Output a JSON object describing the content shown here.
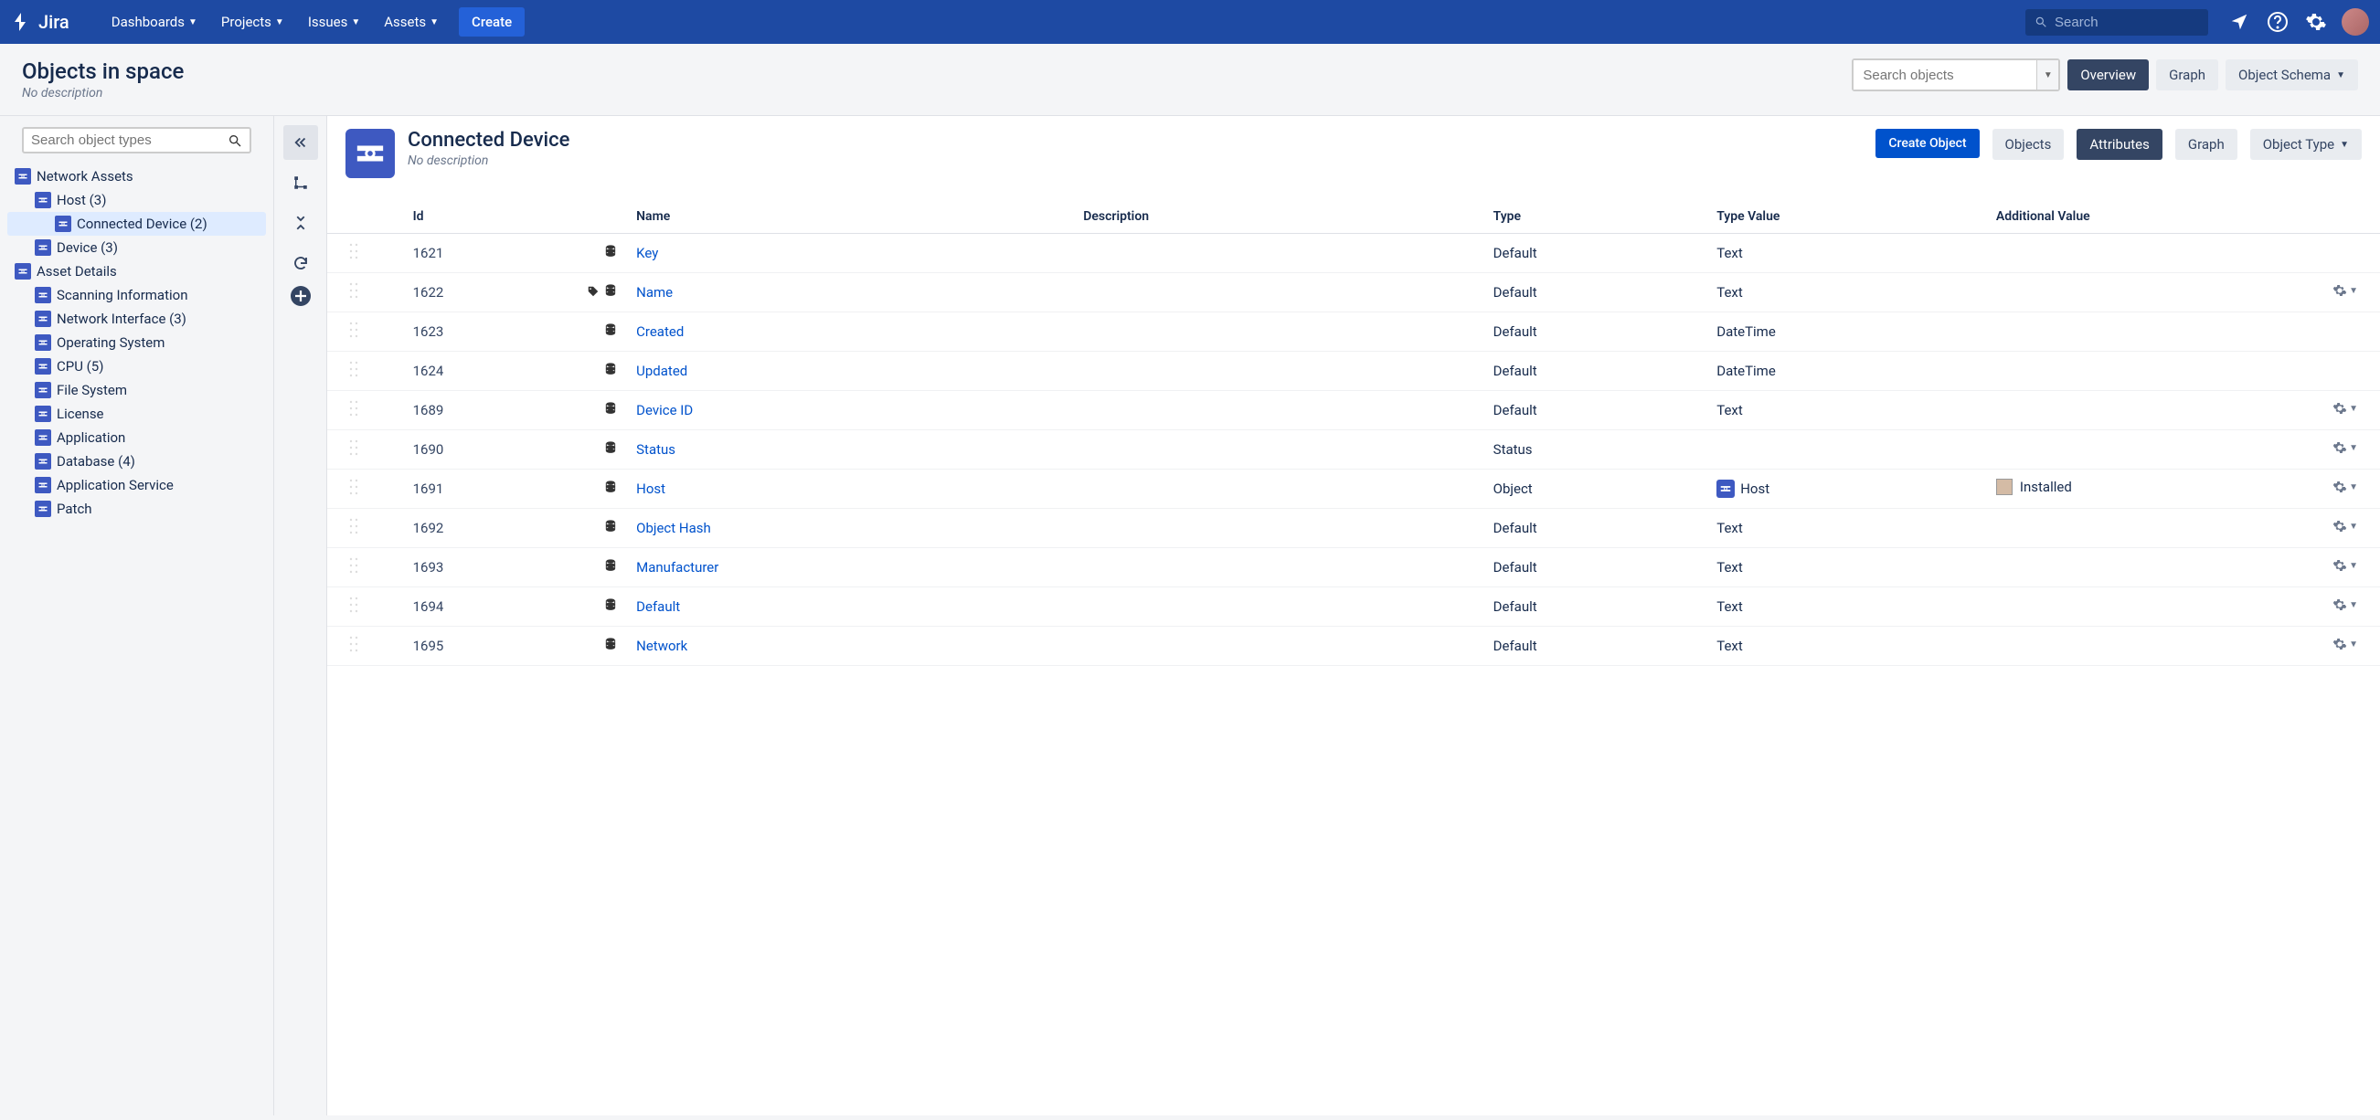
{
  "topnav": {
    "logo": "Jira",
    "items": [
      "Dashboards",
      "Projects",
      "Issues",
      "Assets"
    ],
    "create": "Create",
    "search_placeholder": "Search"
  },
  "pagehead": {
    "title": "Objects in space",
    "desc": "No description",
    "search_placeholder": "Search objects",
    "overview": "Overview",
    "graph": "Graph",
    "schema": "Object Schema"
  },
  "sidebar": {
    "search_placeholder": "Search object types",
    "tree": [
      {
        "label": "Network Assets",
        "indent": 0
      },
      {
        "label": "Host (3)",
        "indent": 1
      },
      {
        "label": "Connected Device (2)",
        "indent": 2,
        "selected": true
      },
      {
        "label": "Device (3)",
        "indent": 1
      },
      {
        "label": "Asset Details",
        "indent": 0
      },
      {
        "label": "Scanning Information",
        "indent": 1
      },
      {
        "label": "Network Interface (3)",
        "indent": 1
      },
      {
        "label": "Operating System",
        "indent": 1
      },
      {
        "label": "CPU (5)",
        "indent": 1
      },
      {
        "label": "File System",
        "indent": 1
      },
      {
        "label": "License",
        "indent": 1
      },
      {
        "label": "Application",
        "indent": 1
      },
      {
        "label": "Database (4)",
        "indent": 1
      },
      {
        "label": "Application Service",
        "indent": 1
      },
      {
        "label": "Patch",
        "indent": 1
      }
    ]
  },
  "content": {
    "title": "Connected Device",
    "desc": "No description",
    "create": "Create Object",
    "tabs": {
      "objects": "Objects",
      "attributes": "Attributes",
      "graph": "Graph",
      "type": "Object Type"
    },
    "columns": {
      "id": "Id",
      "name": "Name",
      "desc": "Description",
      "type": "Type",
      "tv": "Type Value",
      "av": "Additional Value"
    },
    "rows": [
      {
        "id": "1621",
        "name": "Key",
        "type": "Default",
        "tv": "Text",
        "gear": false,
        "tag": false
      },
      {
        "id": "1622",
        "name": "Name",
        "type": "Default",
        "tv": "Text",
        "gear": true,
        "tag": true
      },
      {
        "id": "1623",
        "name": "Created",
        "type": "Default",
        "tv": "DateTime",
        "gear": false,
        "tag": false
      },
      {
        "id": "1624",
        "name": "Updated",
        "type": "Default",
        "tv": "DateTime",
        "gear": false,
        "tag": false
      },
      {
        "id": "1689",
        "name": "Device ID",
        "type": "Default",
        "tv": "Text",
        "gear": true,
        "tag": false
      },
      {
        "id": "1690",
        "name": "Status",
        "type": "Status",
        "tv": "",
        "gear": true,
        "tag": false
      },
      {
        "id": "1691",
        "name": "Host",
        "type": "Object",
        "tv": "Host",
        "tv_icon": true,
        "av": "Installed",
        "gear": true,
        "tag": false
      },
      {
        "id": "1692",
        "name": "Object Hash",
        "type": "Default",
        "tv": "Text",
        "gear": true,
        "tag": false
      },
      {
        "id": "1693",
        "name": "Manufacturer",
        "type": "Default",
        "tv": "Text",
        "gear": true,
        "tag": false
      },
      {
        "id": "1694",
        "name": "Default",
        "type": "Default",
        "tv": "Text",
        "gear": true,
        "tag": false
      },
      {
        "id": "1695",
        "name": "Network",
        "type": "Default",
        "tv": "Text",
        "gear": true,
        "tag": false
      }
    ]
  }
}
